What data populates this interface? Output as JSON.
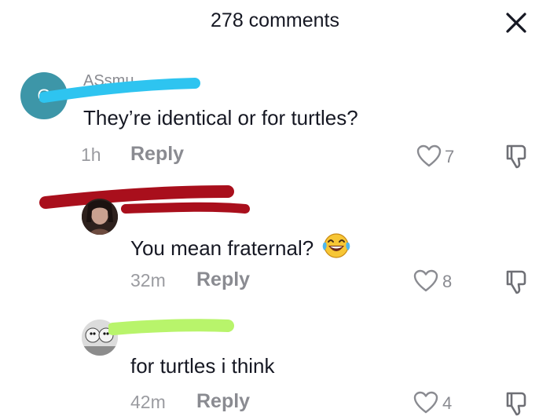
{
  "header": {
    "title": "278 comments",
    "close_icon": "close-icon"
  },
  "comments": [
    {
      "avatar_letter": "G",
      "username": "ASsmu...",
      "text": "They’re identical or for turtles?",
      "time": "1h",
      "reply_label": "Reply",
      "likes": "7",
      "redaction_color": "#2ec4f0"
    },
    {
      "username": "",
      "text": "You mean fraternal?",
      "emoji": "laughing-crying-emoji",
      "time": "32m",
      "reply_label": "Reply",
      "likes": "8",
      "redaction_color": "#a90f1c"
    },
    {
      "username": "",
      "text": "for turtles i think",
      "time": "42m",
      "reply_label": "Reply",
      "likes": "4",
      "redaction_color": "#b8f46b"
    }
  ],
  "colors": {
    "text": "#161823",
    "muted": "#8a8b91",
    "avatar_bg": "#3d96a8"
  }
}
